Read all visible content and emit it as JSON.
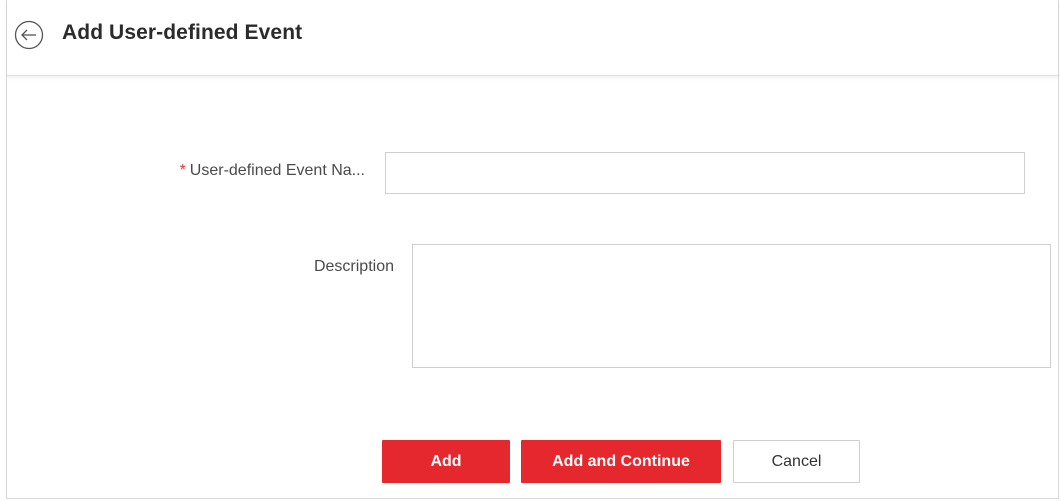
{
  "header": {
    "back_icon": "arrow-left-circle-icon",
    "title": "Add User-defined Event"
  },
  "form": {
    "name_field": {
      "required_marker": "*",
      "label": "User-defined Event Na...",
      "value": "",
      "placeholder": ""
    },
    "description_field": {
      "label": "Description",
      "value": "",
      "placeholder": ""
    }
  },
  "actions": {
    "add_label": "Add",
    "add_continue_label": "Add and Continue",
    "cancel_label": "Cancel"
  },
  "colors": {
    "primary": "#e5282e",
    "required": "#e8353a",
    "border": "#cfcfcf"
  }
}
